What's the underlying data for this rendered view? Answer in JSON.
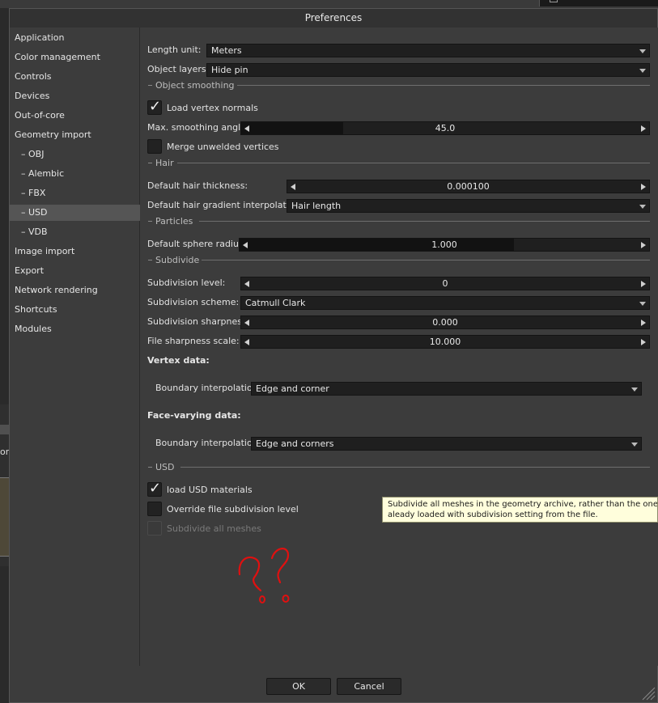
{
  "window": {
    "title": "Preferences"
  },
  "sidebar": {
    "items": [
      {
        "label": "Application"
      },
      {
        "label": "Color management"
      },
      {
        "label": "Controls"
      },
      {
        "label": "Devices"
      },
      {
        "label": "Out-of-core"
      },
      {
        "label": "Geometry import"
      },
      {
        "label": "–  OBJ"
      },
      {
        "label": "–  Alembic"
      },
      {
        "label": "–  FBX"
      },
      {
        "label": "–  USD",
        "selected": true
      },
      {
        "label": "–  VDB"
      },
      {
        "label": "Image import"
      },
      {
        "label": "Export"
      },
      {
        "label": "Network rendering"
      },
      {
        "label": "Shortcuts"
      },
      {
        "label": "Modules"
      }
    ]
  },
  "general": {
    "length_unit": {
      "label": "Length unit:",
      "value": "Meters"
    },
    "object_layers": {
      "label": "Object layers:",
      "value": "Hide pin"
    }
  },
  "object_smoothing": {
    "title": "Object smoothing",
    "load_vertex_normals": {
      "label": "Load vertex normals",
      "checked": true
    },
    "max_smoothing_angle": {
      "label": "Max. smoothing angle:",
      "value": "45.0",
      "fraction": 0.25
    },
    "merge_unwelded": {
      "label": "Merge unwelded vertices",
      "checked": false
    }
  },
  "hair": {
    "title": "Hair",
    "thickness": {
      "label": "Default hair thickness:",
      "value": "0.000100",
      "fraction": 0
    },
    "gradient": {
      "label": "Default hair gradient interpolation:",
      "value": "Hair length"
    }
  },
  "particles": {
    "title": "Particles",
    "sphere_radius": {
      "label": "Default sphere radius:",
      "value": "1.000",
      "fraction": 0.67
    }
  },
  "subdivide": {
    "title": "Subdivide",
    "level": {
      "label": "Subdivision level:",
      "value": "0",
      "fraction": 0
    },
    "scheme": {
      "label": "Subdivision scheme:",
      "value": "Catmull Clark"
    },
    "sharpness": {
      "label": "Subdivision sharpness:",
      "value": "0.000",
      "fraction": 0
    },
    "file_sharpness": {
      "label": "File sharpness scale:",
      "value": "10.000",
      "fraction": 0
    }
  },
  "vertex_data": {
    "title": "Vertex data:",
    "boundary": {
      "label": "Boundary interpolation:",
      "value": "Edge and corner"
    }
  },
  "face_varying": {
    "title": "Face-varying data:",
    "boundary": {
      "label": "Boundary interpolation:",
      "value": "Edge and corners"
    }
  },
  "usd": {
    "title": "USD",
    "load_materials": {
      "label": "load USD materials",
      "checked": true
    },
    "override_subdivision": {
      "label": "Override file subdivision level",
      "checked": false
    },
    "subdivide_all": {
      "label": "Subdivide all meshes",
      "checked": false,
      "disabled": true
    }
  },
  "tooltip": {
    "line1": "Subdivide all meshes in the geometry archive, rather than the ones that are",
    "line2": "aleady loaded with subdivision setting from the file."
  },
  "buttons": {
    "ok": "OK",
    "cancel": "Cancel"
  },
  "background": {
    "left_text": "or"
  },
  "colors": {
    "panel": "#3c3c3c",
    "field": "#1f1f1f",
    "selected": "#555555",
    "tooltip": "#fffedc",
    "annotation": "#e01010"
  },
  "icons": [
    "left-arrow-icon",
    "right-arrow-icon",
    "dropdown-arrow-icon",
    "checkmark-icon",
    "resize-grip-icon"
  ]
}
